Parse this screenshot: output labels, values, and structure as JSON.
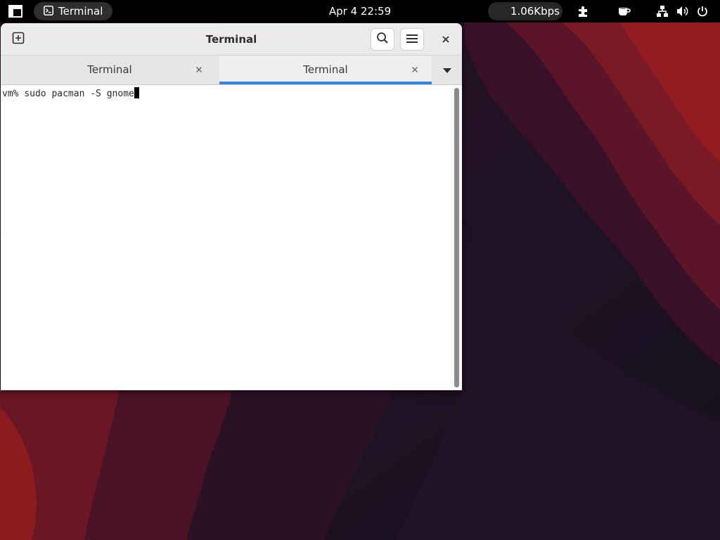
{
  "topbar": {
    "app_name": "Terminal",
    "clock": "Apr 4  22:59",
    "net_speed": "1.06Kbps"
  },
  "window": {
    "title": "Terminal",
    "tabs": [
      {
        "label": "Terminal",
        "active": false
      },
      {
        "label": "Terminal",
        "active": true
      }
    ]
  },
  "terminal": {
    "prompt": "vm% ",
    "command": "sudo pacman -S gnome"
  },
  "colors": {
    "topbar_bg": "#000000",
    "accent": "#3584e4",
    "wallpaper_dark": "#1b1220",
    "wallpaper_red": "#8c1a1f"
  },
  "icons": [
    "activities-icon",
    "terminal-app-icon",
    "extensions-icon",
    "caffeine-icon",
    "network-icon",
    "volume-icon",
    "power-icon",
    "new-tab-icon",
    "search-icon",
    "hamburger-menu-icon",
    "close-icon",
    "tab-close-icon",
    "chevron-down-icon"
  ]
}
